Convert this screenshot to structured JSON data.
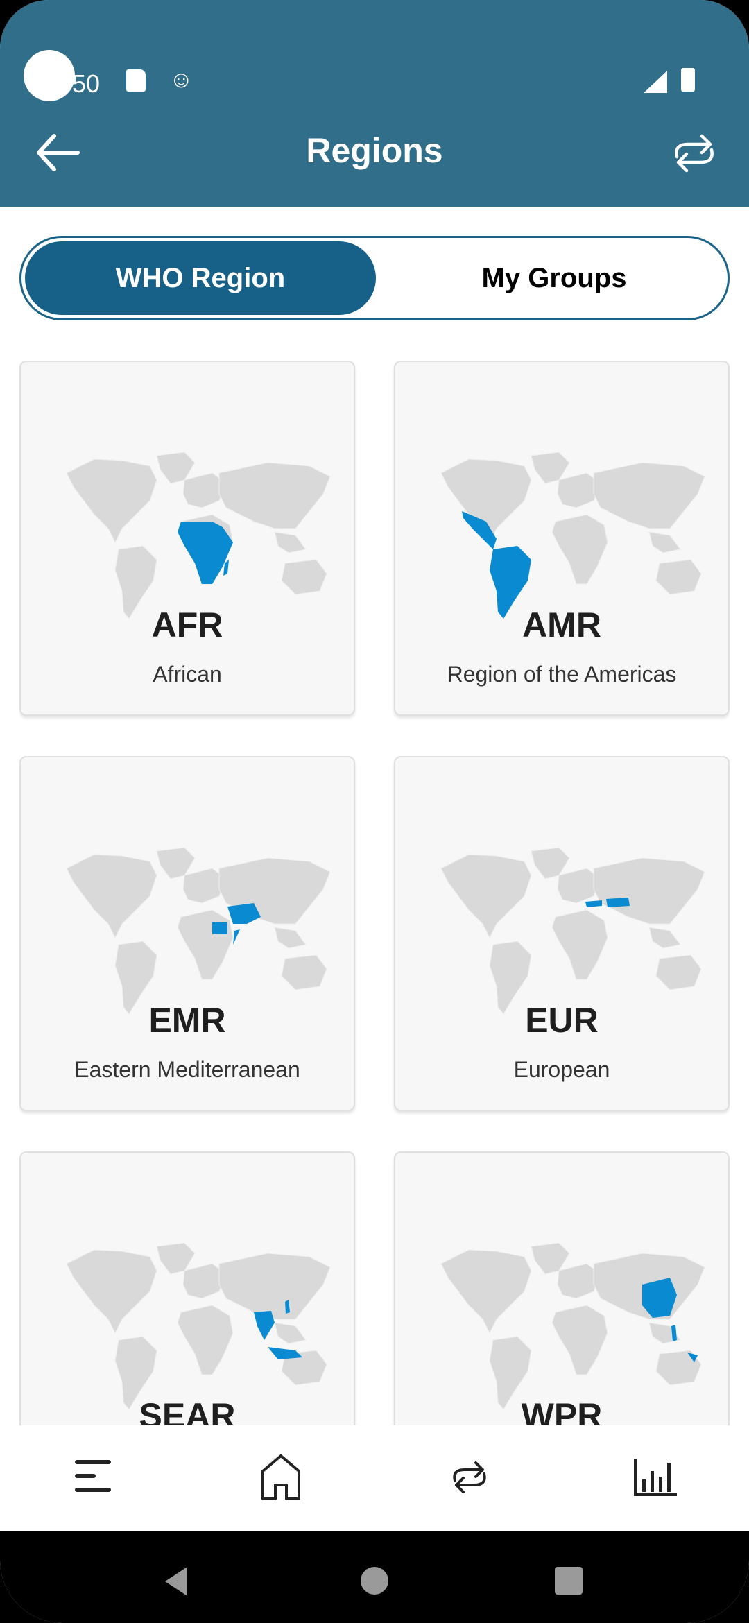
{
  "status_bar": {
    "time_fragment": "50",
    "icons": [
      "camera-cutout",
      "sd-card-icon",
      "android-debug-icon",
      "signal-icon",
      "battery-icon"
    ]
  },
  "header": {
    "title": "Regions",
    "back_icon": "arrow-left-icon",
    "action_icon": "swap-arrows-icon"
  },
  "segment": {
    "options": [
      {
        "label": "WHO Region",
        "selected": true
      },
      {
        "label": "My Groups",
        "selected": false
      }
    ]
  },
  "colors": {
    "appbar": "#316e8a",
    "segment_active": "#176189",
    "highlight": "#0a8ad0",
    "land": "#d9d9d9",
    "card_bg": "#f7f7f7"
  },
  "regions": [
    {
      "code": "AFR",
      "name": "African",
      "highlight": "Africa"
    },
    {
      "code": "AMR",
      "name": "Region of the Americas",
      "highlight": "Latin America"
    },
    {
      "code": "EMR",
      "name": "Eastern Mediterranean",
      "highlight": "Middle East"
    },
    {
      "code": "EUR",
      "name": "European",
      "highlight": "Turkey / Central Asia"
    },
    {
      "code": "SEAR",
      "name": "",
      "highlight": "South Asia / Indonesia"
    },
    {
      "code": "WPR",
      "name": "",
      "highlight": "China / Western Pacific"
    }
  ],
  "bottom_nav": {
    "items": [
      {
        "icon": "menu-icon"
      },
      {
        "icon": "home-icon"
      },
      {
        "icon": "swap-arrows-icon"
      },
      {
        "icon": "bar-chart-icon"
      }
    ]
  },
  "system_nav": {
    "items": [
      "back-triangle",
      "home-circle",
      "recents-square"
    ]
  }
}
